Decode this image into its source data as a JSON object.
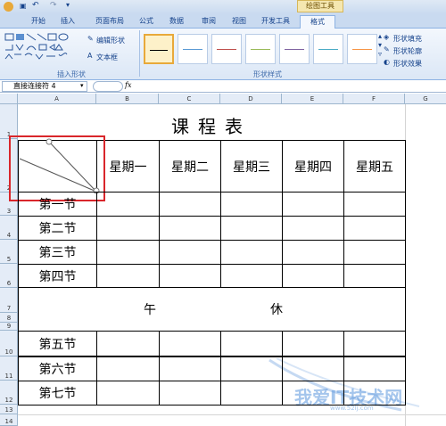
{
  "ribbon": {
    "context_tab": "绘图工具",
    "tabs": [
      "开始",
      "插入",
      "页面布局",
      "公式",
      "数据",
      "审阅",
      "视图",
      "开发工具",
      "格式"
    ],
    "active_tab": "格式",
    "edit_shape": "编辑形状",
    "textbox": "文本框",
    "group_insert_shapes": "插入形状",
    "group_shape_styles": "形状样式",
    "shape_fill": "形状填充",
    "shape_outline": "形状轮廓",
    "shape_effects": "形状效果",
    "style_colors": [
      "#000000",
      "#5b9bd5",
      "#c0504d",
      "#9bbb59",
      "#8064a2",
      "#4bacc6",
      "#f79646"
    ]
  },
  "formula_bar": {
    "name_box": "直接连接符 4",
    "fx": "fx"
  },
  "columns": [
    "A",
    "B",
    "C",
    "D",
    "E",
    "F",
    "G"
  ],
  "rows": [
    "1",
    "2",
    "3",
    "4",
    "5",
    "6",
    "7",
    "8",
    "9",
    "10",
    "11",
    "12",
    "13",
    "14"
  ],
  "sheet": {
    "title": "课程表",
    "weekdays": [
      "星期一",
      "星期二",
      "星期三",
      "星期四",
      "星期五"
    ],
    "periods_morning": [
      "第一节",
      "第二节",
      "第三节",
      "第四节"
    ],
    "noon_left": "午",
    "noon_right": "休",
    "periods_afternoon": [
      "第五节",
      "第六节",
      "第七节"
    ]
  },
  "watermark": {
    "text": "我爱IT技术网",
    "sub": "www.52ij.com"
  }
}
